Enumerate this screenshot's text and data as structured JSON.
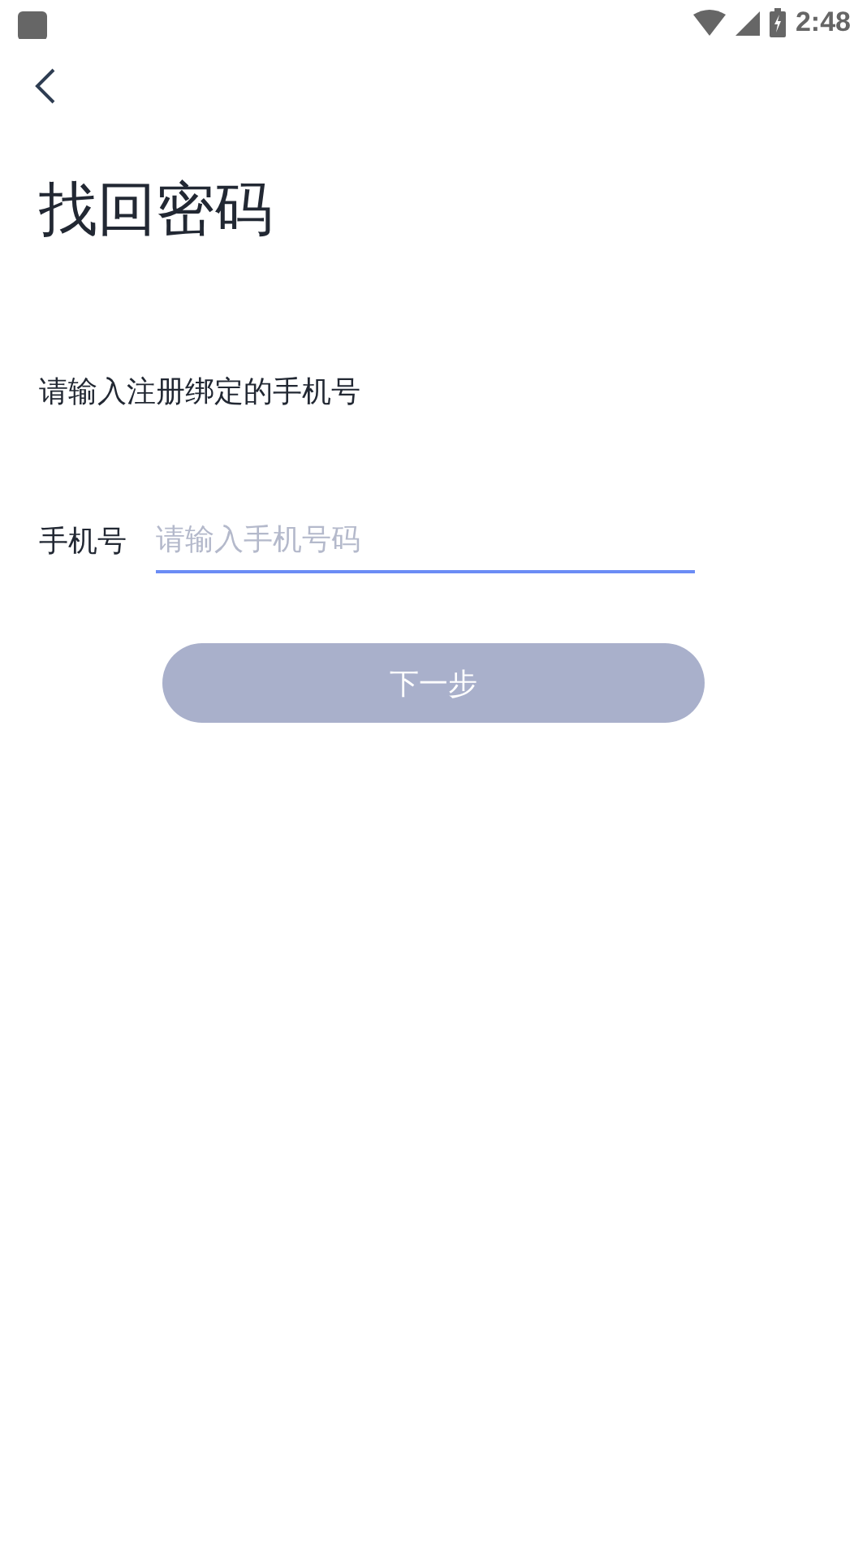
{
  "status_bar": {
    "time": "2:48"
  },
  "title": "找回密码",
  "instruction": "请输入注册绑定的手机号",
  "phone_field": {
    "label": "手机号",
    "placeholder": "请输入手机号码"
  },
  "next_button": {
    "label": "下一步",
    "disabled": true
  }
}
